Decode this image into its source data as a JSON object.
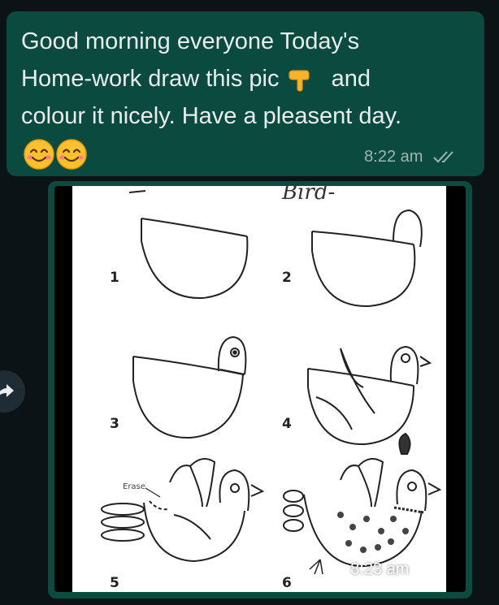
{
  "messages": {
    "text": {
      "line1": "Good morning everyone Today's",
      "line2a": "Home-work draw this pic",
      "line2b": "and",
      "line3": "colour it nicely. Have a pleasent day.",
      "time": "8:22 am"
    },
    "image": {
      "time": "8:23 am",
      "caption_partial": "Bird-",
      "step_numbers": [
        "1",
        "2",
        "3",
        "4",
        "5",
        "6"
      ],
      "erase_label": "Erase"
    }
  },
  "colors": {
    "background": "#0c1317",
    "bubble": "#0b4a3f",
    "text": "#e9edef",
    "meta": "#9fb7b1"
  },
  "icons": [
    "backhand-index-pointing-down-emoji",
    "smiling-face-emoji",
    "double-check-icon",
    "forward-arrow-icon"
  ]
}
